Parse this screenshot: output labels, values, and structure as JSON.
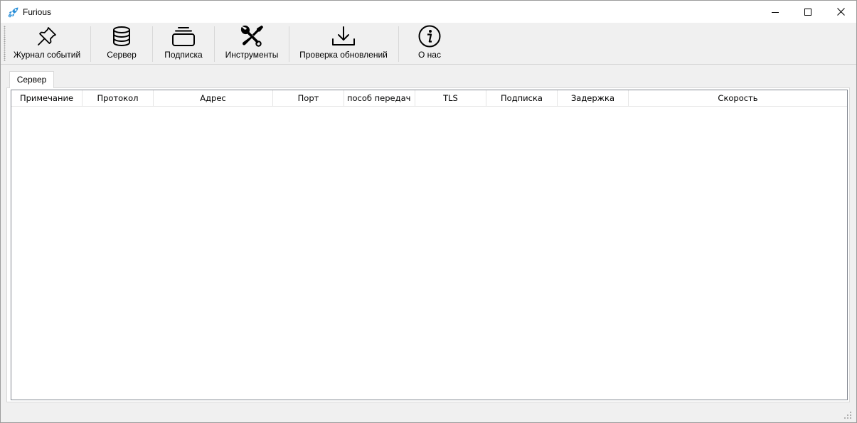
{
  "window": {
    "title": "Furious",
    "app_icon": "rocket-icon"
  },
  "toolbar": {
    "items": [
      {
        "label": "Журнал событий",
        "icon": "pin-icon"
      },
      {
        "label": "Сервер",
        "icon": "database-icon"
      },
      {
        "label": "Подписка",
        "icon": "stack-icon"
      },
      {
        "label": "Инструменты",
        "icon": "tools-icon"
      },
      {
        "label": "Проверка обновлений",
        "icon": "download-icon"
      },
      {
        "label": "О нас",
        "icon": "info-icon"
      }
    ]
  },
  "tabs": [
    {
      "label": "Сервер",
      "active": true
    }
  ],
  "table": {
    "columns": [
      "Примечание",
      "Протокол",
      "Адрес",
      "Порт",
      "пособ  передач",
      "TLS",
      "Подписка",
      "Задержка",
      "Скорость"
    ],
    "rows": []
  },
  "colors": {
    "accent": "#2a8fd8",
    "border": "#828790"
  }
}
